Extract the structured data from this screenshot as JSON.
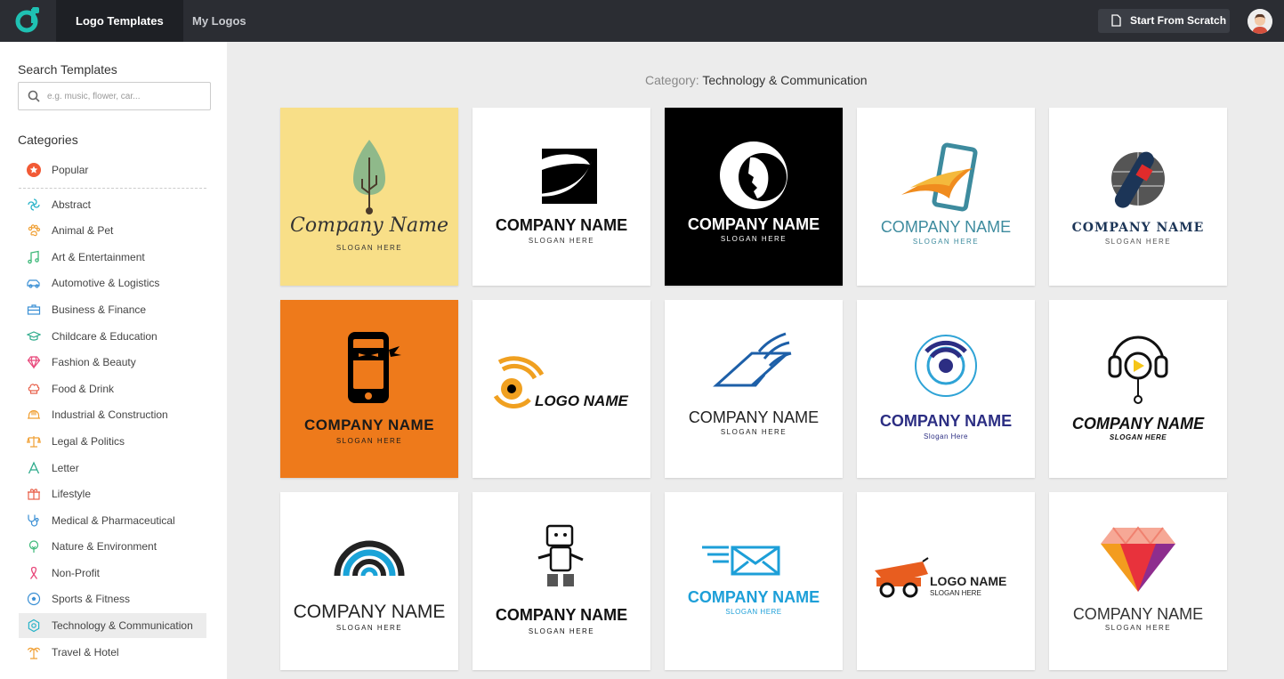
{
  "nav": {
    "tabs": [
      {
        "label": "Logo Templates"
      },
      {
        "label": "My Logos"
      }
    ],
    "start_btn": "Start From Scratch"
  },
  "sidebar": {
    "search_title": "Search Templates",
    "search_placeholder": "e.g. music, flower, car...",
    "categories_title": "Categories",
    "categories": [
      {
        "label": "Popular",
        "icon": "star-icon"
      },
      {
        "label": "Abstract",
        "icon": "abstract-icon"
      },
      {
        "label": "Animal & Pet",
        "icon": "paw-icon"
      },
      {
        "label": "Art & Entertainment",
        "icon": "music-note-icon"
      },
      {
        "label": "Automotive & Logistics",
        "icon": "car-icon"
      },
      {
        "label": "Business & Finance",
        "icon": "briefcase-icon"
      },
      {
        "label": "Childcare & Education",
        "icon": "graduation-cap-icon"
      },
      {
        "label": "Fashion & Beauty",
        "icon": "diamond-icon"
      },
      {
        "label": "Food & Drink",
        "icon": "chef-hat-icon"
      },
      {
        "label": "Industrial & Construction",
        "icon": "helmet-icon"
      },
      {
        "label": "Legal & Politics",
        "icon": "scales-icon"
      },
      {
        "label": "Letter",
        "icon": "letter-a-icon"
      },
      {
        "label": "Lifestyle",
        "icon": "gift-icon"
      },
      {
        "label": "Medical & Pharmaceutical",
        "icon": "stethoscope-icon"
      },
      {
        "label": "Nature & Environment",
        "icon": "tree-icon"
      },
      {
        "label": "Non-Profit",
        "icon": "ribbon-icon"
      },
      {
        "label": "Sports & Fitness",
        "icon": "soccer-ball-icon"
      },
      {
        "label": "Technology & Communication",
        "icon": "chip-icon"
      },
      {
        "label": "Travel & Hotel",
        "icon": "palm-tree-icon"
      }
    ]
  },
  "main": {
    "category_label": "Category:",
    "category_value": "Technology & Communication",
    "templates": [
      {
        "name": "Company Name",
        "slogan": "SLOGAN HERE",
        "bg": "#f8df88",
        "icon": "usb-leaf-icon"
      },
      {
        "name": "COMPANY NAME",
        "slogan": "SLOGAN HERE",
        "bg": "#ffffff",
        "icon": "swoosh-square-icon"
      },
      {
        "name": "COMPANY NAME",
        "slogan": "SLOGAN HERE",
        "bg": "#000000",
        "icon": "astronaut-helmet-icon"
      },
      {
        "name": "COMPANY NAME",
        "slogan": "SLOGAN HERE",
        "bg": "#ffffff",
        "icon": "fast-phone-icon"
      },
      {
        "name": "COMPANY NAME",
        "slogan": "SLOGAN HERE",
        "bg": "#ffffff",
        "icon": "globe-microphone-icon"
      },
      {
        "name": "COMPANY NAME",
        "slogan": "SLOGAN HERE",
        "bg": "#ee7a1b",
        "icon": "ninja-phone-icon"
      },
      {
        "name": "LOGO NAME",
        "slogan": "",
        "bg": "#ffffff",
        "icon": "signal-eye-icon"
      },
      {
        "name": "COMPANY NAME",
        "slogan": "SLOGAN HERE",
        "bg": "#ffffff",
        "icon": "laptop-wing-icon"
      },
      {
        "name": "COMPANY NAME",
        "slogan": "Slogan Here",
        "bg": "#ffffff",
        "icon": "wifi-target-icon"
      },
      {
        "name": "COMPANY NAME",
        "slogan": "SLOGAN HERE",
        "bg": "#ffffff",
        "icon": "headphones-play-icon"
      },
      {
        "name": "COMPANY NAME",
        "slogan": "SLOGAN HERE",
        "bg": "#ffffff",
        "icon": "signal-arch-icon"
      },
      {
        "name": "COMPANY NAME",
        "slogan": "SLOGAN HERE",
        "bg": "#ffffff",
        "icon": "robot-icon"
      },
      {
        "name": "COMPANY NAME",
        "slogan": "SLOGAN HERE",
        "bg": "#ffffff",
        "icon": "winged-envelope-icon"
      },
      {
        "name": "LOGO NAME",
        "slogan": "SLOGAN HERE",
        "bg": "#ffffff",
        "icon": "cannon-icon"
      },
      {
        "name": "COMPANY NAME",
        "slogan": "SLOGAN HERE",
        "bg": "#ffffff",
        "icon": "gem-icon"
      }
    ]
  }
}
